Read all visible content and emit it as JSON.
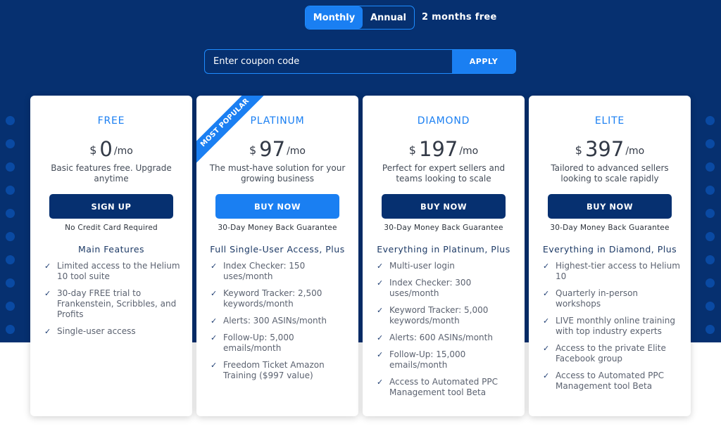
{
  "billing": {
    "monthly_label": "Monthly",
    "annual_label": "Annual",
    "annual_note": "2 months free"
  },
  "coupon": {
    "placeholder": "Enter coupon code",
    "apply_label": "APPLY"
  },
  "colors": {
    "hero_background": "#063070",
    "accent": "#1a7ff2",
    "dark_button": "#063070"
  },
  "plans": [
    {
      "name": "FREE",
      "currency": "$",
      "amount": "0",
      "period": "/mo",
      "description": "Basic features free. Upgrade anytime",
      "cta": "SIGN UP",
      "cta_note": "No Credit Card Required",
      "features_title": "Main Features",
      "features": [
        "Limited access to the Helium 10 tool suite",
        "30-day FREE trial to Frankenstein, Scribbles, and Profits",
        "Single-user access"
      ]
    },
    {
      "name": "PLATINUM",
      "ribbon": "MOST POPULAR",
      "currency": "$",
      "amount": "97",
      "period": "/mo",
      "description": "The must-have solution for your growing business",
      "cta": "BUY NOW",
      "cta_note": "30-Day Money Back Guarantee",
      "features_title": "Full Single-User Access, Plus",
      "features": [
        "Index Checker: 150 uses/month",
        "Keyword Tracker: 2,500 keywords/month",
        "Alerts: 300 ASINs/month",
        "Follow-Up: 5,000 emails/month",
        "Freedom Ticket Amazon Training ($997 value)"
      ]
    },
    {
      "name": "DIAMOND",
      "currency": "$",
      "amount": "197",
      "period": "/mo",
      "description": "Perfect for expert sellers and teams looking to scale",
      "cta": "BUY NOW",
      "cta_note": "30-Day Money Back Guarantee",
      "features_title": "Everything in Platinum, Plus",
      "features": [
        "Multi-user login",
        "Index Checker: 300 uses/month",
        "Keyword Tracker: 5,000 keywords/month",
        "Alerts: 600 ASINs/month",
        "Follow-Up: 15,000 emails/month",
        "Access to Automated PPC Management tool Beta"
      ]
    },
    {
      "name": "ELITE",
      "currency": "$",
      "amount": "397",
      "period": "/mo",
      "description": "Tailored to advanced sellers looking to scale rapidly",
      "cta": "BUY NOW",
      "cta_note": "30-Day Money Back Guarantee",
      "features_title": "Everything in Diamond, Plus",
      "features": [
        "Highest-tier access to Helium 10",
        "Quarterly in-person workshops",
        "LIVE monthly online training with top industry experts",
        "Access to the private Elite Facebook group",
        "Access to Automated PPC Management tool Beta"
      ]
    }
  ]
}
